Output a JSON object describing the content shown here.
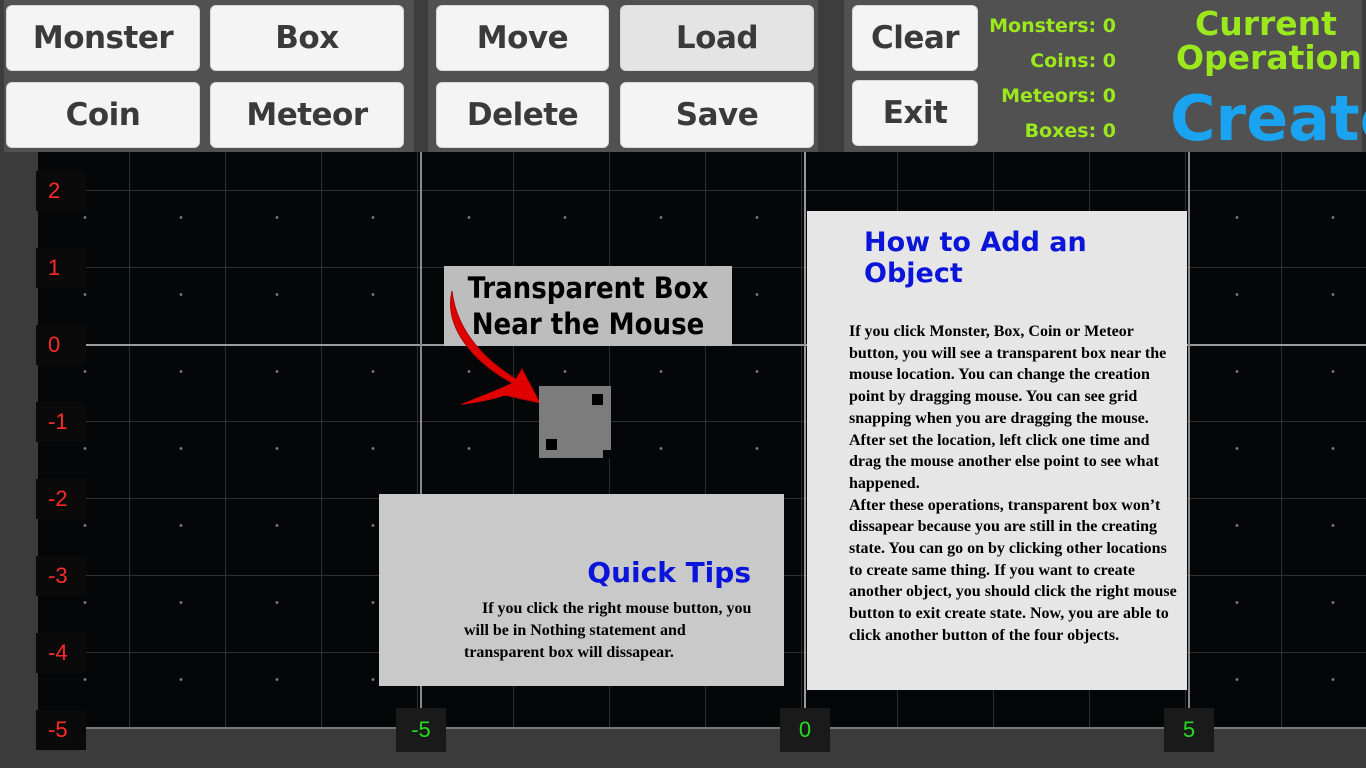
{
  "toolbar": {
    "buttons": {
      "monster": "Monster",
      "box": "Box",
      "coin": "Coin",
      "meteor": "Meteor",
      "move": "Move",
      "load": "Load",
      "delete": "Delete",
      "save": "Save",
      "clear": "Clear",
      "exit": "Exit"
    },
    "counters": {
      "monsters": "Monsters: 0",
      "coins": "Coins: 0",
      "meteors": "Meteors: 0",
      "boxes": "Boxes: 0"
    },
    "operation": {
      "title_line1": "Current",
      "title_line2": "Operation",
      "mode": "Create"
    }
  },
  "grid": {
    "y_labels": [
      "2",
      "1",
      "0",
      "-1",
      "-2",
      "-3",
      "-4",
      "-5"
    ],
    "x_labels": [
      "-5",
      "0",
      "5"
    ]
  },
  "annotation": {
    "line1": "Transparent Box",
    "line2": "Near the Mouse"
  },
  "quick_tips": {
    "title": "Quick Tips",
    "body": "If you click the right mouse button, you will be in Nothing statement and transparent box will dissapear."
  },
  "howto": {
    "title": "How to Add an Object",
    "body": "If you click Monster, Box, Coin or Meteor button, you will see a transparent box near the mouse location. You can change the creation point by dragging mouse. You can see grid snapping when you are dragging the mouse. After set the location, left click one time and drag the mouse another else point to see what happened.\nAfter these operations, transparent box won’t dissapear because you are still in the creating state. You can go on by clicking other locations to create same thing. If you want to create another object, you should click the right mouse button to exit create state. Now, you are able to click another button of the four objects."
  },
  "colors": {
    "accent_green": "#9be81d",
    "mode_blue": "#1aa3f0",
    "tip_title_blue": "#0b14d9",
    "y_axis_red": "#ff2a2a",
    "x_axis_green": "#22dd22"
  }
}
